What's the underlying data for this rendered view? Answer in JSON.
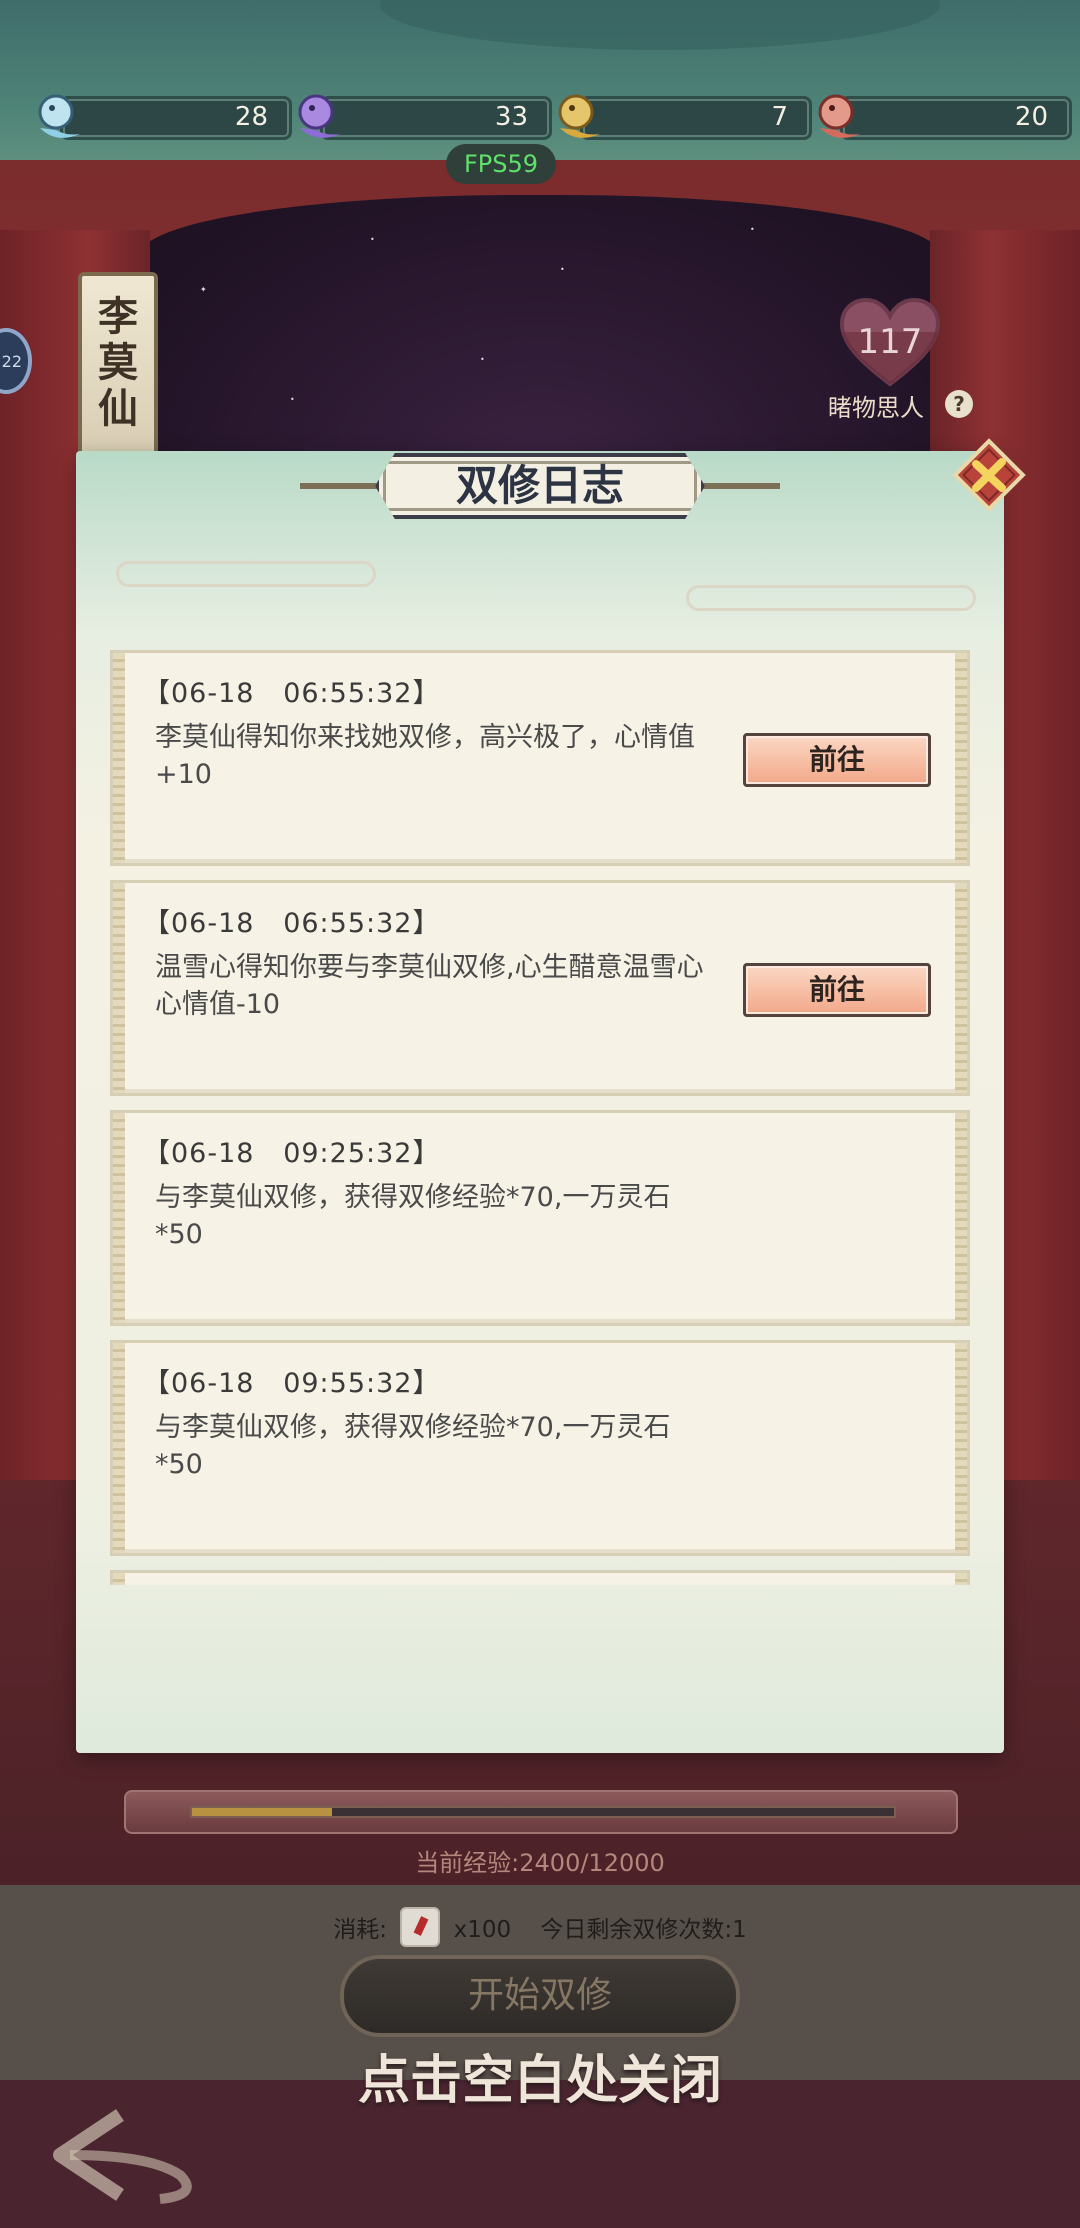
{
  "currencies": [
    {
      "name": "blue-fish",
      "value": "28",
      "color": "#bfe4f0"
    },
    {
      "name": "purple-fish",
      "value": "33",
      "color": "#a98ae0"
    },
    {
      "name": "gold-fish",
      "value": "7",
      "color": "#e6c66a"
    },
    {
      "name": "red-fish",
      "value": "20",
      "color": "#e49a8a"
    }
  ],
  "fps": "FPS59",
  "character": {
    "name_chars": [
      "李",
      "莫",
      "仙"
    ],
    "side_badge": "22",
    "heart_value": "117",
    "heart_label": "睹物思人",
    "help": "?"
  },
  "modal": {
    "title": "双修日志",
    "entries": [
      {
        "time": "【06-18   06:55:32】",
        "text": "李莫仙得知你来找她双修，高兴极了，心情值+10",
        "button": "前往"
      },
      {
        "time": "【06-18   06:55:32】",
        "text": "温雪心得知你要与李莫仙双修,心生醋意温雪心心情值-10",
        "button": "前往"
      },
      {
        "time": "【06-18   09:25:32】",
        "text": "与李莫仙双修，获得双修经验*70,一万灵石*50",
        "button": ""
      },
      {
        "time": "【06-18   09:55:32】",
        "text": "与李莫仙双修，获得双修经验*70,一万灵石*50",
        "button": ""
      }
    ]
  },
  "exp": {
    "label": "当前经验:2400/12000",
    "current": 2400,
    "max": 12000
  },
  "cost": {
    "label": "消耗:",
    "amount": "x100",
    "remaining": "今日剩余双修次数:1"
  },
  "start_button": "开始双修",
  "close_hint": "点击空白处关闭",
  "colors": {
    "accent_button": "#f2a889",
    "modal_bg": "#f4f1e3",
    "fps_text": "#5ee26a"
  }
}
